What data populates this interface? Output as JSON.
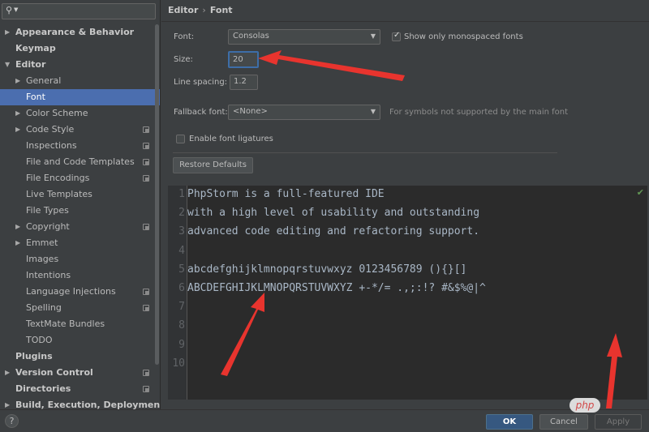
{
  "search": {
    "icon": "search-icon",
    "value": ""
  },
  "tree": [
    {
      "label": "Appearance & Behavior",
      "level": 0,
      "bold": true,
      "expand": "collapsed",
      "project": false,
      "selected": false
    },
    {
      "label": "Keymap",
      "level": 0,
      "bold": true,
      "expand": "none",
      "project": false,
      "selected": false
    },
    {
      "label": "Editor",
      "level": 0,
      "bold": true,
      "expand": "expanded",
      "project": false,
      "selected": false
    },
    {
      "label": "General",
      "level": 1,
      "bold": false,
      "expand": "collapsed",
      "project": false,
      "selected": false
    },
    {
      "label": "Font",
      "level": 1,
      "bold": false,
      "expand": "none",
      "project": false,
      "selected": true
    },
    {
      "label": "Color Scheme",
      "level": 1,
      "bold": false,
      "expand": "collapsed",
      "project": false,
      "selected": false
    },
    {
      "label": "Code Style",
      "level": 1,
      "bold": false,
      "expand": "collapsed",
      "project": true,
      "selected": false
    },
    {
      "label": "Inspections",
      "level": 1,
      "bold": false,
      "expand": "none",
      "project": true,
      "selected": false
    },
    {
      "label": "File and Code Templates",
      "level": 1,
      "bold": false,
      "expand": "none",
      "project": true,
      "selected": false
    },
    {
      "label": "File Encodings",
      "level": 1,
      "bold": false,
      "expand": "none",
      "project": true,
      "selected": false
    },
    {
      "label": "Live Templates",
      "level": 1,
      "bold": false,
      "expand": "none",
      "project": false,
      "selected": false
    },
    {
      "label": "File Types",
      "level": 1,
      "bold": false,
      "expand": "none",
      "project": false,
      "selected": false
    },
    {
      "label": "Copyright",
      "level": 1,
      "bold": false,
      "expand": "collapsed",
      "project": true,
      "selected": false
    },
    {
      "label": "Emmet",
      "level": 1,
      "bold": false,
      "expand": "collapsed",
      "project": false,
      "selected": false
    },
    {
      "label": "Images",
      "level": 1,
      "bold": false,
      "expand": "none",
      "project": false,
      "selected": false
    },
    {
      "label": "Intentions",
      "level": 1,
      "bold": false,
      "expand": "none",
      "project": false,
      "selected": false
    },
    {
      "label": "Language Injections",
      "level": 1,
      "bold": false,
      "expand": "none",
      "project": true,
      "selected": false
    },
    {
      "label": "Spelling",
      "level": 1,
      "bold": false,
      "expand": "none",
      "project": true,
      "selected": false
    },
    {
      "label": "TextMate Bundles",
      "level": 1,
      "bold": false,
      "expand": "none",
      "project": false,
      "selected": false
    },
    {
      "label": "TODO",
      "level": 1,
      "bold": false,
      "expand": "none",
      "project": false,
      "selected": false
    },
    {
      "label": "Plugins",
      "level": 0,
      "bold": true,
      "expand": "none",
      "project": false,
      "selected": false
    },
    {
      "label": "Version Control",
      "level": 0,
      "bold": true,
      "expand": "collapsed",
      "project": true,
      "selected": false
    },
    {
      "label": "Directories",
      "level": 0,
      "bold": true,
      "expand": "none",
      "project": true,
      "selected": false
    },
    {
      "label": "Build, Execution, Deployment",
      "level": 0,
      "bold": true,
      "expand": "collapsed",
      "project": false,
      "selected": false
    }
  ],
  "breadcrumb": {
    "parent": "Editor",
    "separator": "›",
    "current": "Font"
  },
  "settings": {
    "font_label": "Font:",
    "font_value": "Consolas",
    "mono_checkbox_label": "Show only monospaced fonts",
    "mono_checked": true,
    "size_label": "Size:",
    "size_value": "20",
    "line_spacing_label": "Line spacing:",
    "line_spacing_value": "1.2",
    "fallback_label": "Fallback font:",
    "fallback_value": "<None>",
    "fallback_hint": "For symbols not supported by the main font",
    "ligatures_label": "Enable font ligatures",
    "ligatures_checked": false,
    "restore_label": "Restore Defaults"
  },
  "preview": {
    "lines": [
      {
        "n": "1",
        "text": "PhpStorm is a full-featured IDE"
      },
      {
        "n": "2",
        "text": "with a high level of usability and outstanding"
      },
      {
        "n": "3",
        "text": "advanced code editing and refactoring support."
      },
      {
        "n": "4",
        "text": ""
      },
      {
        "n": "5",
        "text": "abcdefghijklmnopqrstuvwxyz 0123456789 (){}[]"
      },
      {
        "n": "6",
        "text": "ABCDEFGHIJKLMNOPQRSTUVWXYZ +-*/= .,;:!? #&$%@|^"
      },
      {
        "n": "7",
        "text": ""
      },
      {
        "n": "8",
        "text": ""
      },
      {
        "n": "9",
        "text": ""
      },
      {
        "n": "10",
        "text": ""
      }
    ],
    "status_icon": "check-icon"
  },
  "footer": {
    "help_label": "?",
    "ok_label": "OK",
    "cancel_label": "Cancel",
    "apply_label": "Apply"
  },
  "watermark": {
    "text": "php"
  },
  "colors": {
    "selection": "#4b6eaf",
    "ok_button": "#365880",
    "annotation_arrow": "#e8342e"
  }
}
